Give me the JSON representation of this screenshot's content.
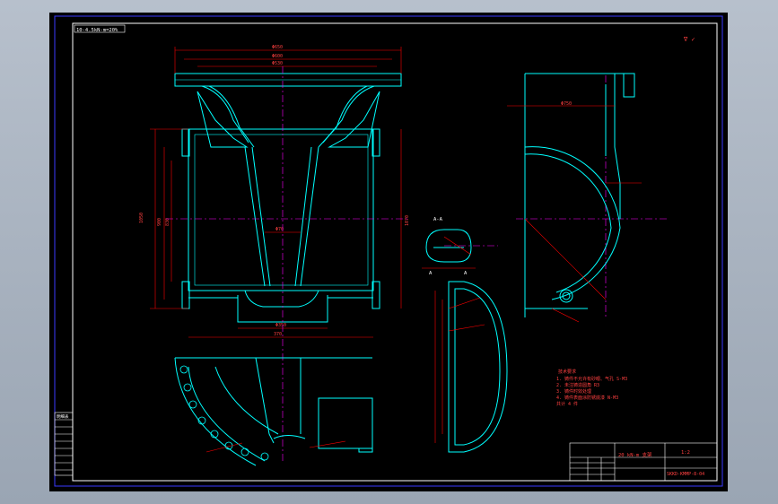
{
  "drawing": {
    "title_strip": "10-4.5kN-m=20%",
    "corner_mark": "∇ ✓",
    "section_label": "A-A",
    "section_letter_left": "A",
    "section_letter_right": "A",
    "dimensions": {
      "top_overall": "Φ650",
      "top_second": "Φ600",
      "top_third": "Φ530",
      "bottom_span": "370",
      "bottom_mid": "Φ350",
      "left_height": "1050",
      "left_inner": "900",
      "left_inner2": "830",
      "right_height": "1070",
      "center_width": "Φ70",
      "right_view_width": "Φ750",
      "tech_req_head": "技术要求"
    },
    "tech_requirements": [
      "1. 铸件不允许有砂眼、气孔 S-M3",
      "2. 未注铸造圆角 R3",
      "3. 铸件时效处理",
      "4. 铸件表面涂防锈底漆 N-M3",
      "   共计 4 件"
    ],
    "title_block": {
      "part_name": "20 kN-m 支架",
      "drawing_no": "SKKD-KMMP-8-04",
      "scale": "1:2",
      "left_table_header": "明细表"
    }
  },
  "colors": {
    "background": "#000000",
    "outline": "#00ffff",
    "dimension": "#ff0000",
    "centerline": "#ff00ff",
    "border": "#0000ff",
    "text": "#ffffff"
  }
}
